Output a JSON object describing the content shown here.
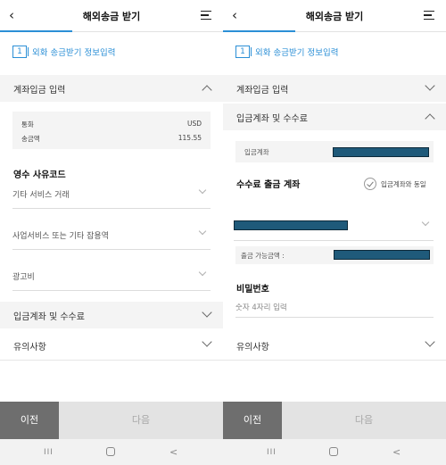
{
  "header": {
    "title": "해외송금 받기"
  },
  "step": {
    "number": "1",
    "label": "외화 송금받기 정보입력"
  },
  "left": {
    "account_section": "계좌입금 입력",
    "currency": {
      "label": "통화",
      "value": "USD"
    },
    "amount": {
      "label": "송금액",
      "value": "115.55"
    },
    "reason_label": "영수 사유코드",
    "selects": [
      "기타 서비스 거래",
      "사업서비스 또는 기타 잡용역",
      "광고비"
    ],
    "deposit_fee_section": "입금계좌 및 수수료",
    "notice": "유의사항"
  },
  "right": {
    "account_section": "계좌입금 입력",
    "deposit_fee_section": "입금계좌 및 수수료",
    "deposit_account_label": "입금계좌",
    "fee_account_label": "수수료 출금 계좌",
    "same_as_deposit": "입금계좌와 동일",
    "available_amount_label": "출금 가능금액 :",
    "password_label": "비밀번호",
    "password_placeholder": "숫자 4자리 입력",
    "notice": "유의사항"
  },
  "footer": {
    "prev": "이전",
    "next": "다음"
  },
  "navbar": {
    "recent": "III",
    "home": "",
    "back": "<"
  },
  "colors": {
    "accent": "#2b8fd6",
    "masked": "#1f5a7a",
    "prev_button": "#6e6e6e",
    "next_button": "#e3e3e3"
  },
  "icons": [
    "back-arrow-icon",
    "menu-icon",
    "chevron-icon",
    "check-circle-icon"
  ]
}
